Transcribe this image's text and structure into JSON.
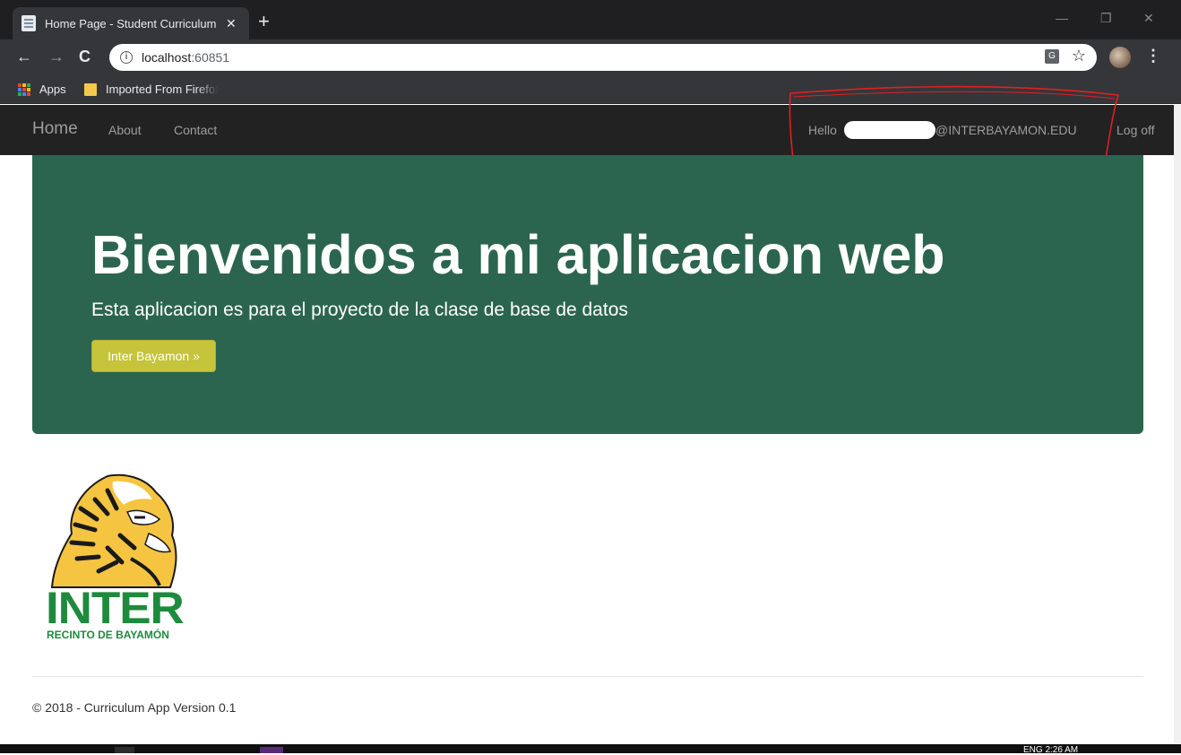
{
  "browser": {
    "tab_title": "Home Page - Student Curriculum",
    "tab_close": "✕",
    "new_tab": "+",
    "url_host": "localhost",
    "url_port": ":60851",
    "bookmarks": [
      {
        "label": "Apps"
      },
      {
        "label": "Imported From Firefox"
      }
    ]
  },
  "navbar": {
    "brand": "Home",
    "links": [
      "About",
      "Contact"
    ],
    "greeting": "Hello",
    "email_suffix": "@INTERBAYAMON.EDU",
    "logoff": "Log off"
  },
  "jumbotron": {
    "title": "Bienvenidos a mi aplicacion web",
    "lead": "Esta aplicacion es para el proyecto de la clase de base de datos",
    "button_label": "Inter Bayamon »"
  },
  "logo": {
    "wordmark": "INTER",
    "subtitle": "RECINTO DE BAYAMÓN"
  },
  "footer": {
    "text": "© 2018 - Curriculum App Version 0.1"
  },
  "taskbar": {
    "clock": "ENG    2:26 AM"
  },
  "colors": {
    "navbar_bg": "#222222",
    "jumbotron_bg": "#2b654f",
    "button_bg": "#c5c43a",
    "annotation": "#e02020",
    "logo_green": "#1e8a3d"
  }
}
